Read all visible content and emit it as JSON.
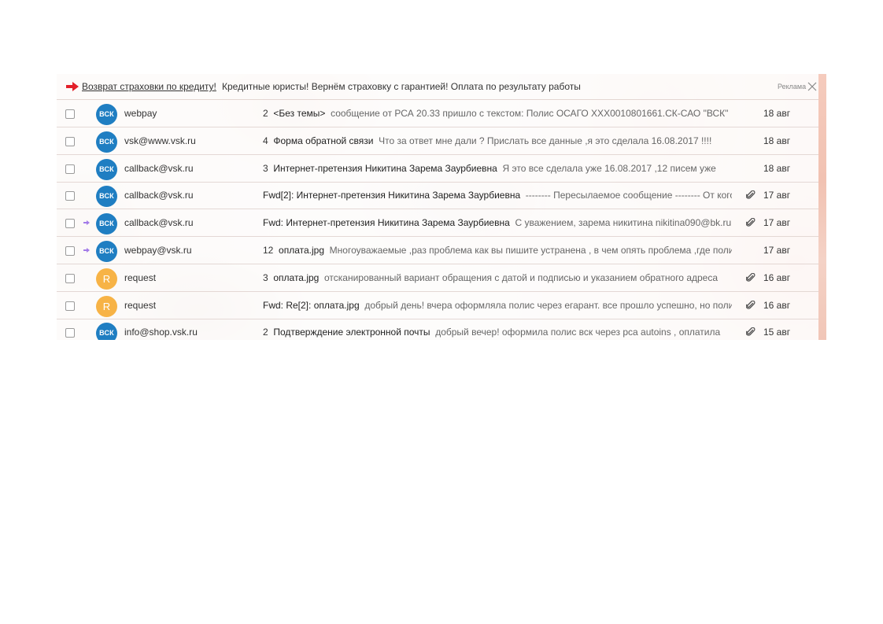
{
  "ad": {
    "link": "Возврат страховки по кредиту!",
    "text": "Кредитные юристы! Вернём страховку с гарантией! Оплата по результату работы",
    "label": "Реклама"
  },
  "colors": {
    "vsk_avatar": "#1f7ec2",
    "r_avatar": "#f7b346",
    "ad_arrow": "#e3202a",
    "forward_arrow": "#a37be8"
  },
  "messages": [
    {
      "sender": "webpay",
      "avatar": "ВСК",
      "avatar_type": "vsk",
      "forwarded": false,
      "count": "2",
      "subject": "<Без темы>",
      "snippet": "сообщение от РСА 20.33 пришло с текстом: Полис ОСАГО ХХХ0010801661.СК-САО \"ВСК\"",
      "attachment": false,
      "date": "18 авг"
    },
    {
      "sender": "vsk@www.vsk.ru",
      "avatar": "ВСК",
      "avatar_type": "vsk",
      "forwarded": false,
      "count": "4",
      "subject": "Форма обратной связи",
      "snippet": "Что за ответ мне дали ? Прислать все данные ,я это сделала 16.08.2017 !!!!",
      "attachment": false,
      "date": "18 авг"
    },
    {
      "sender": "callback@vsk.ru",
      "avatar": "ВСК",
      "avatar_type": "vsk",
      "forwarded": false,
      "count": "3",
      "subject": "Интернет-претензия Никитина Зарема Заурбиевна",
      "snippet": "Я это все сделала уже 16.08.2017 ,12 писем уже",
      "attachment": false,
      "date": "18 авг"
    },
    {
      "sender": "callback@vsk.ru",
      "avatar": "ВСК",
      "avatar_type": "vsk",
      "forwarded": false,
      "count": "",
      "subject": "Fwd[2]: Интернет-претензия Никитина Зарема Заурбиевна",
      "snippet": "-------- Пересылаемое сообщение -------- От кого",
      "attachment": true,
      "date": "17 авг"
    },
    {
      "sender": "callback@vsk.ru",
      "avatar": "ВСК",
      "avatar_type": "vsk",
      "forwarded": true,
      "count": "",
      "subject": "Fwd: Интернет-претензия Никитина Зарема Заурбиевна",
      "snippet": "С уважением, зарема никитина nikitina090@bk.ru",
      "attachment": true,
      "date": "17 авг"
    },
    {
      "sender": "webpay@vsk.ru",
      "avatar": "ВСК",
      "avatar_type": "vsk",
      "forwarded": true,
      "count": "12",
      "subject": "оплата.jpg",
      "snippet": "Многоуважаемые ,раз проблема как вы пишите устранена , в чем опять проблема ,где полис",
      "attachment": false,
      "date": "17 авг"
    },
    {
      "sender": "request",
      "avatar": "R",
      "avatar_type": "r",
      "forwarded": false,
      "count": "3",
      "subject": "оплата.jpg",
      "snippet": "отсканированный вариант обращения с датой и подписью и указанием обратного адреса",
      "attachment": true,
      "date": "16 авг"
    },
    {
      "sender": "request",
      "avatar": "R",
      "avatar_type": "r",
      "forwarded": false,
      "count": "",
      "subject": "Fwd: Re[2]: оплата.jpg",
      "snippet": "добрый день! вчера оформляла полис через егарант. все прошло успешно, но полис",
      "attachment": true,
      "date": "16 авг"
    },
    {
      "sender": "info@shop.vsk.ru",
      "avatar": "ВСК",
      "avatar_type": "vsk",
      "forwarded": false,
      "count": "2",
      "subject": "Подтверждение электронной почты",
      "snippet": "добрый вечер! оформила полис вск через рса autoins , оплатила",
      "attachment": true,
      "date": "15 авг"
    }
  ]
}
